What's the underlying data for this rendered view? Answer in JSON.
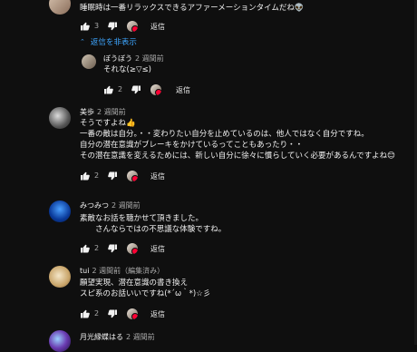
{
  "comments": [
    {
      "text": "睡眠時は一番リラックスできるアファーメーションタイムだね👽",
      "likes": "3",
      "reply_label": "返信",
      "toggle_label": "返信を非表示"
    },
    {
      "author": "ぼうぼう",
      "time": "2 週間前",
      "text": "それな(≥▽≤)",
      "likes": "2",
      "reply_label": "返信"
    },
    {
      "author": "美歩",
      "time": "2 週間前",
      "text_lines": [
        "そうですよね👍",
        "一番の敵は自分。・・変わりたい自分を止めているのは、他人ではなく自分ですね。",
        "自分の潜在意識がブレーキをかけているってこともあったり・・",
        "その潜在意識を変えるためには、新しい自分に徐々に慣らしていく必要があるんですよね😊"
      ],
      "likes": "2",
      "reply_label": "返信"
    },
    {
      "author": "みつみつ",
      "time": "2 週間前",
      "text_lines": [
        "素敵なお話を聴かせて頂きました。",
        "　　さんならではの不思議な体験ですね。"
      ],
      "likes": "2",
      "reply_label": "返信"
    },
    {
      "author": "tui",
      "time": "2 週間前（編集済み）",
      "text_lines": [
        "願望実現、潜在意識の書き換え",
        "スピ系のお話いいですね(*´ω｀*)☆彡"
      ],
      "likes": "2",
      "reply_label": "返信"
    },
    {
      "author": "月光縁蝶はる",
      "time": "2 週間前"
    }
  ],
  "colors": {
    "background": "#0f0f0f",
    "text": "#f1f1f1",
    "secondary": "#aaaaaa",
    "link": "#3ea6ff",
    "heart": "#ff0033"
  }
}
